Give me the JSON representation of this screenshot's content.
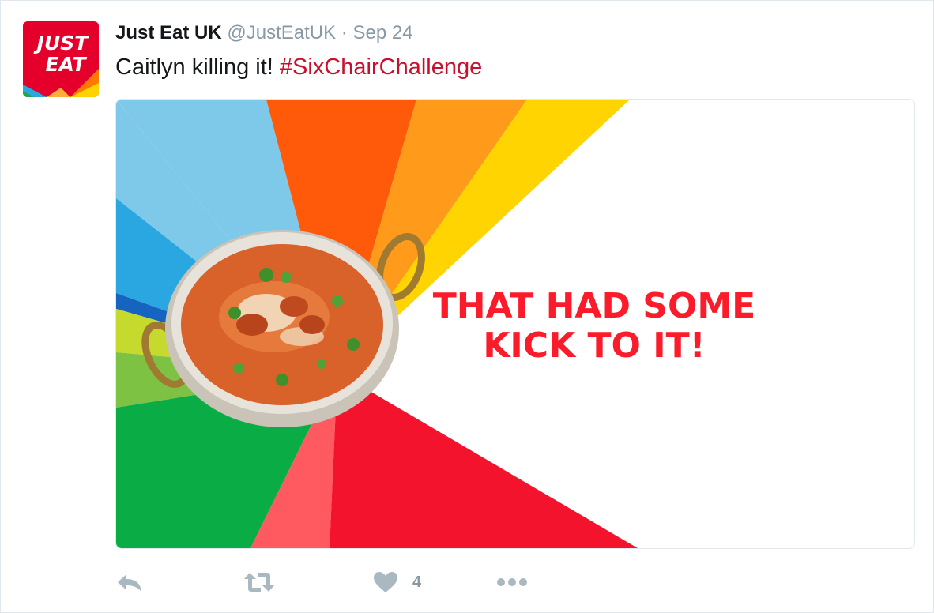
{
  "tweet": {
    "author_name": "Just Eat UK",
    "author_handle": "@JustEatUK",
    "separator": "·",
    "timestamp": "Sep 24",
    "text": "Caitlyn killing it! ",
    "hashtag": "#SixChairChallenge"
  },
  "avatar": {
    "logo_line1": "JUST",
    "logo_line2": "EAT",
    "brand_color": "#e4002b"
  },
  "media": {
    "headline_line1": "THAT HAD SOME",
    "headline_line2": "KICK TO IT!",
    "headline_color": "#fb1b2a"
  },
  "actions": {
    "reply_icon": "reply-icon",
    "retweet_icon": "retweet-icon",
    "like_icon": "heart-icon",
    "like_count": "4",
    "more_icon": "more-icon",
    "icon_color": "#aab8c2"
  }
}
